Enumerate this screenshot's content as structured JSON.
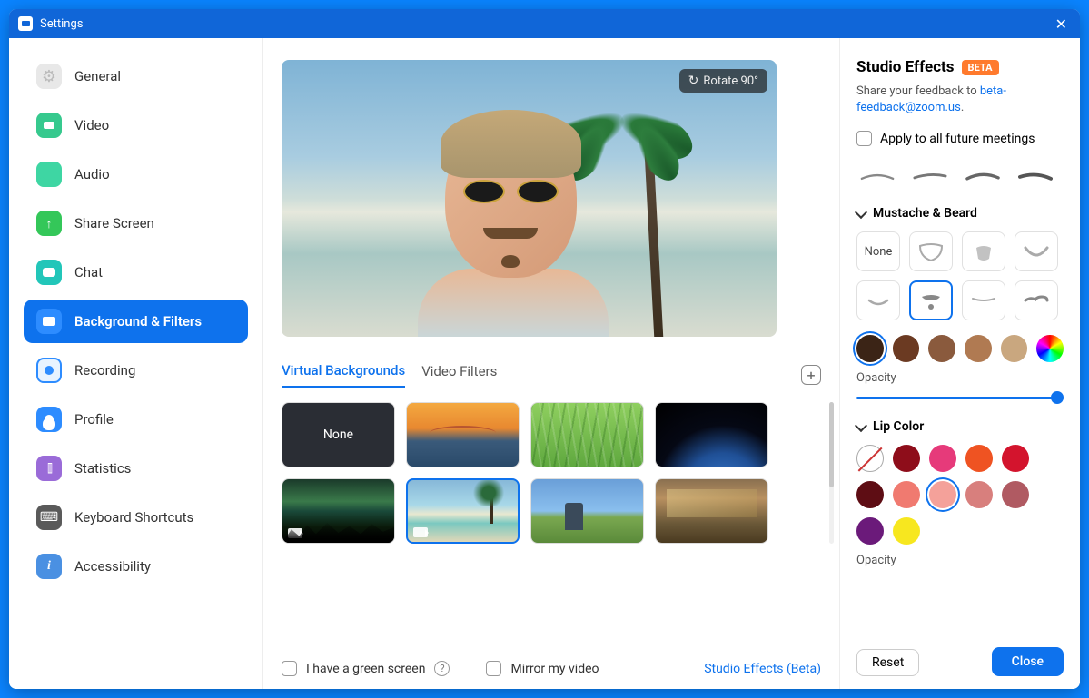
{
  "window": {
    "title": "Settings"
  },
  "sidebar": {
    "items": [
      {
        "label": "General"
      },
      {
        "label": "Video"
      },
      {
        "label": "Audio"
      },
      {
        "label": "Share Screen"
      },
      {
        "label": "Chat"
      },
      {
        "label": "Background & Filters"
      },
      {
        "label": "Recording"
      },
      {
        "label": "Profile"
      },
      {
        "label": "Statistics"
      },
      {
        "label": "Keyboard Shortcuts"
      },
      {
        "label": "Accessibility"
      }
    ],
    "active_index": 5
  },
  "preview": {
    "rotate_label": "Rotate 90°"
  },
  "tabs": {
    "items": [
      {
        "label": "Virtual Backgrounds"
      },
      {
        "label": "Video Filters"
      }
    ],
    "active_index": 0
  },
  "backgrounds": {
    "none_label": "None",
    "selected_index": 5,
    "items": [
      "none",
      "bridge",
      "grass",
      "earth",
      "aurora",
      "beach",
      "animation",
      "room"
    ]
  },
  "options": {
    "green_screen": "I have a green screen",
    "mirror": "Mirror my video",
    "studio_link": "Studio Effects (Beta)"
  },
  "studio": {
    "title": "Studio Effects",
    "badge": "BETA",
    "feedback_prefix": "Share your feedback to ",
    "feedback_email": "beta-feedback@zoom.us",
    "feedback_suffix": ".",
    "apply_label": "Apply to all future meetings",
    "sections": {
      "mustache": {
        "title": "Mustache & Beard",
        "none_label": "None",
        "selected_index": 5
      },
      "lip": {
        "title": "Lip Color",
        "selected_index": 7
      }
    },
    "beard_colors": [
      "#3b2416",
      "#6b3a22",
      "#8a5a3d",
      "#b07a52",
      "#c9a77f"
    ],
    "beard_selected_color_index": 0,
    "opacity": {
      "label": "Opacity",
      "value": 100
    },
    "lip_colors": [
      "none",
      "#8e0d1a",
      "#e63a7a",
      "#ef5322",
      "#d3142d",
      "#5e0d14",
      "#f07a70",
      "#f4a19a",
      "#d87f7d",
      "#b05a62",
      "#6b1a7a",
      "#f7e71f"
    ],
    "opacity2_label": "Opacity",
    "reset_label": "Reset",
    "close_label": "Close"
  }
}
